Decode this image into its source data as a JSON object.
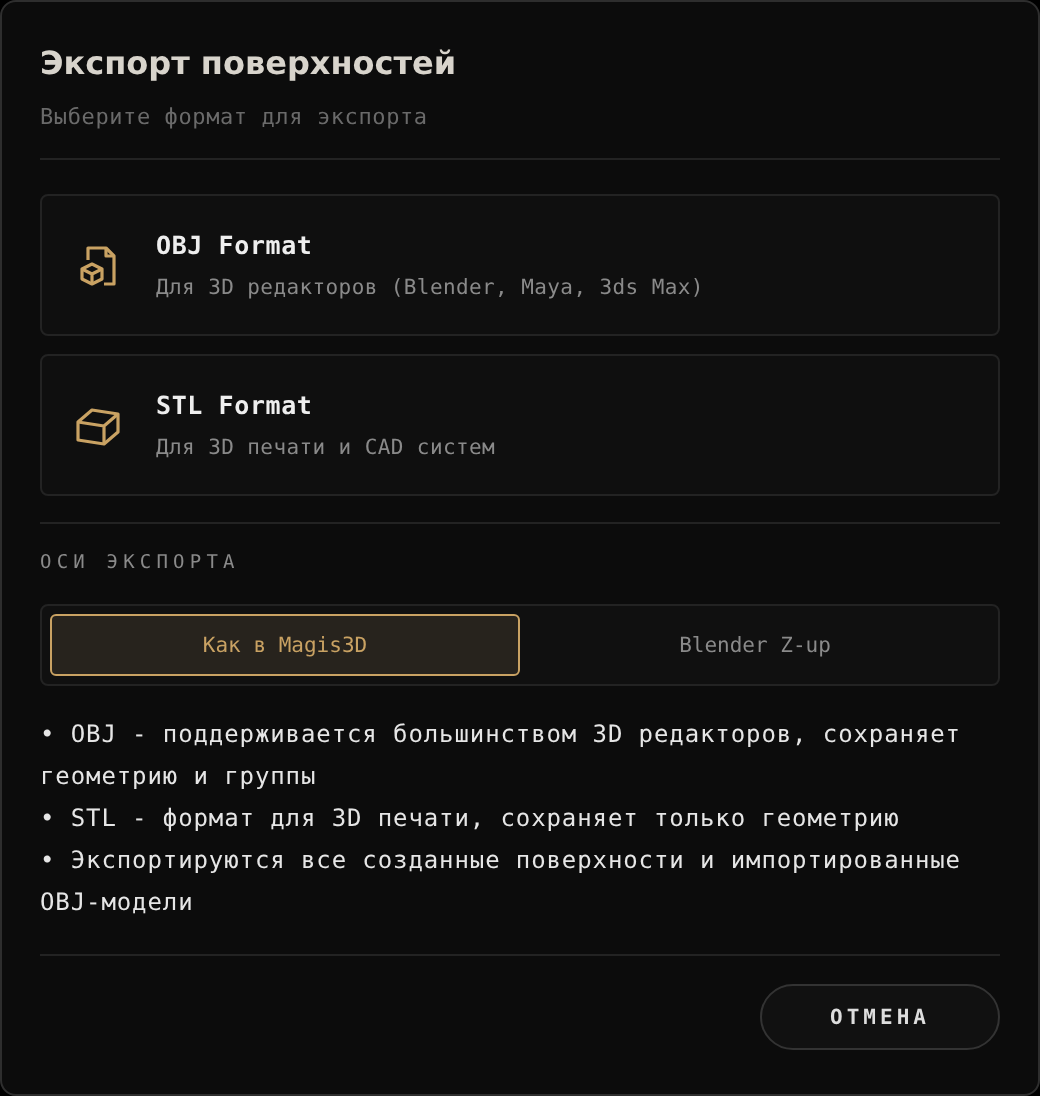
{
  "dialog": {
    "title": "Экспорт поверхностей",
    "subtitle": "Выберите формат для экспорта"
  },
  "formats": [
    {
      "kind": "file",
      "name": "OBJ Format",
      "description": "Для 3D редакторов (Blender, Maya, 3ds Max)"
    },
    {
      "kind": "box",
      "name": "STL Format",
      "description": "Для 3D печати и CAD систем"
    }
  ],
  "axes": {
    "label": "ОСИ ЭКСПОРТА",
    "options": [
      {
        "label": "Как в Magis3D",
        "selected": true
      },
      {
        "label": "Blender Z-up",
        "selected": false
      }
    ]
  },
  "notes": [
    "• OBJ - поддерживается большинством 3D редакторов, сохраняет геометрию и группы",
    "• STL - формат для 3D печати, сохраняет только геометрию",
    "• Экспортируются все созданные поверхности и импортированные OBJ-модели"
  ],
  "buttons": [
    {
      "label": "ОТМЕНА"
    }
  ]
}
